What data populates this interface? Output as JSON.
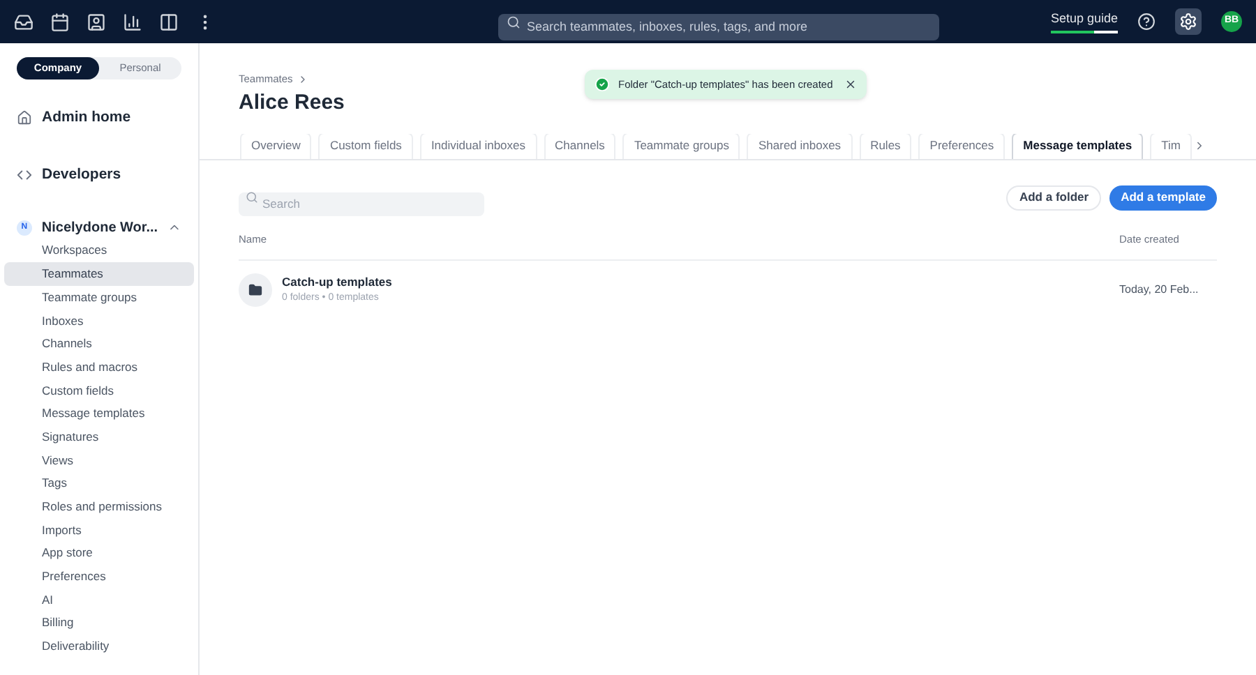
{
  "topbar": {
    "search": {
      "placeholder": "Search teammates, inboxes, rules, tags, and more"
    },
    "setup_guide": {
      "label": "Setup guide",
      "level": 0.65
    },
    "avatar": "BB"
  },
  "sidebar": {
    "scope_tabs": [
      {
        "label": "Company",
        "selected": true
      },
      {
        "label": "Personal",
        "selected": false
      }
    ],
    "sections": [
      {
        "kind": "link",
        "label": "Admin home"
      },
      {
        "kind": "link",
        "label": "Developers"
      }
    ],
    "workspace": {
      "badge": "N",
      "label": "Nicelydone Wor...",
      "expanded": true,
      "items": [
        {
          "label": "Workspaces",
          "selected": false
        },
        {
          "label": "Teammates",
          "selected": true
        },
        {
          "label": "Teammate groups",
          "selected": false
        },
        {
          "label": "Inboxes",
          "selected": false
        },
        {
          "label": "Channels",
          "selected": false
        },
        {
          "label": "Rules and macros",
          "selected": false
        },
        {
          "label": "Custom fields",
          "selected": false
        },
        {
          "label": "Message templates",
          "selected": false
        },
        {
          "label": "Signatures",
          "selected": false
        },
        {
          "label": "Views",
          "selected": false
        },
        {
          "label": "Tags",
          "selected": false
        },
        {
          "label": "Roles and permissions",
          "selected": false
        },
        {
          "label": "Imports",
          "selected": false
        },
        {
          "label": "App store",
          "selected": false
        },
        {
          "label": "Preferences",
          "selected": false
        },
        {
          "label": "AI",
          "selected": false
        },
        {
          "label": "Billing",
          "selected": false
        },
        {
          "label": "Deliverability",
          "selected": false
        }
      ]
    }
  },
  "breadcrumb": "Teammates",
  "title": "Alice Rees",
  "toast": {
    "message": "Folder \"Catch-up templates\" has been created"
  },
  "tabs": [
    {
      "label": "Overview",
      "selected": false
    },
    {
      "label": "Custom fields",
      "selected": false
    },
    {
      "label": "Individual inboxes",
      "selected": false
    },
    {
      "label": "Channels",
      "selected": false
    },
    {
      "label": "Teammate groups",
      "selected": false
    },
    {
      "label": "Shared inboxes",
      "selected": false
    },
    {
      "label": "Rules",
      "selected": false
    },
    {
      "label": "Preferences",
      "selected": false
    },
    {
      "label": "Message templates",
      "selected": true
    },
    {
      "label": "Tim",
      "selected": false
    }
  ],
  "search": {
    "placeholder": "Search"
  },
  "buttons": [
    {
      "label": "Add a folder",
      "kind": "secondary"
    },
    {
      "label": "Add a template",
      "kind": "primary"
    }
  ],
  "table": {
    "columns": [
      "Name",
      "Date created"
    ],
    "rows": [
      {
        "name": "Catch-up templates",
        "detail": "0 folders • 0 templates",
        "date": "Today, 20 Feb..."
      }
    ]
  }
}
